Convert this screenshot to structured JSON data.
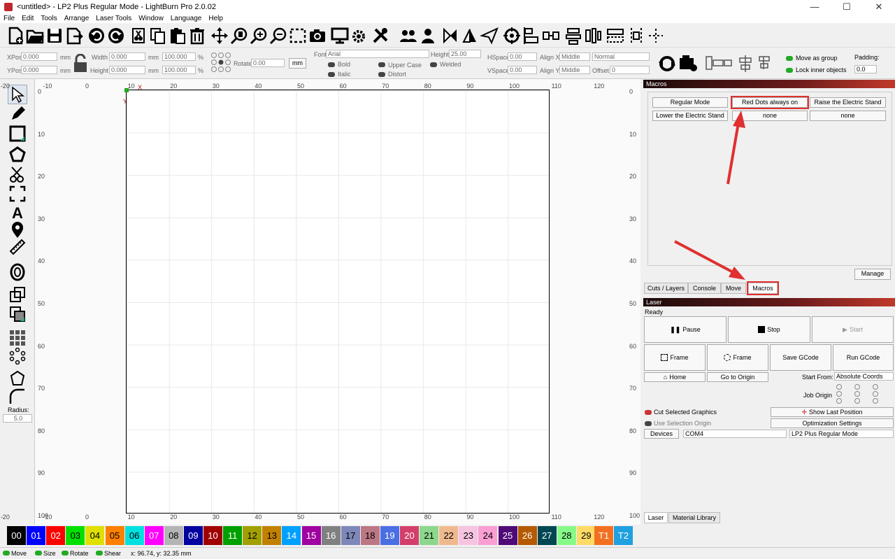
{
  "window": {
    "title": "<untitled> - LP2 Plus Regular Mode - LightBurn Pro 2.0.02",
    "minimize": "—",
    "maximize": "☐",
    "close": "✕"
  },
  "menu": [
    "File",
    "Edit",
    "Tools",
    "Arrange",
    "Laser Tools",
    "Window",
    "Language",
    "Help"
  ],
  "props": {
    "xpos_label": "XPos",
    "xpos_value": "0.000",
    "ypos_label": "YPos",
    "ypos_value": "0.000",
    "unit_mm": "mm",
    "width_label": "Width",
    "width_value": "0.000",
    "height_label": "Height",
    "height_value": "0.000",
    "scale_w": "100.000",
    "scale_h": "100.000",
    "percent": "%",
    "rotate_label": "Rotate",
    "rotate_value": "0.00",
    "mm_button": "mm",
    "font_label": "Font",
    "font_value": "Arial",
    "fheight_label": "Height",
    "fheight_value": "25.00",
    "bold": "Bold",
    "italic": "Italic",
    "upper": "Upper Case",
    "distort": "Distort",
    "welded": "Welded",
    "hspace_label": "HSpace",
    "hspace_value": "0.00",
    "vspace_label": "VSpace",
    "vspace_value": "0.00",
    "alignx_label": "Align X",
    "alignx_value": "Middle",
    "aligny_label": "Align Y",
    "aligny_value": "Middle",
    "normal": "Normal",
    "offset_label": "Offset",
    "offset_value": "0",
    "move_group": "Move as group",
    "lock_inner": "Lock inner objects",
    "padding_label": "Padding:",
    "padding_value": "0.0"
  },
  "left": {
    "radius_label": "Radius:",
    "radius_value": "5.0"
  },
  "ruler_top": [
    "-20",
    "-10",
    "0",
    "10",
    "20",
    "30",
    "40",
    "50",
    "60",
    "70",
    "80",
    "90",
    "100",
    "110",
    "120"
  ],
  "ruler_left": [
    "0",
    "10",
    "20",
    "30",
    "40",
    "50",
    "60",
    "70",
    "80",
    "90",
    "100"
  ],
  "axis_x": "X",
  "axis_y": "Y",
  "macros": {
    "title": "Macros",
    "buttons": [
      "Regular Mode",
      "Red Dots always on",
      "Raise the Electric Stand",
      "Lower the Electric Stand",
      "none",
      "none"
    ],
    "manage": "Manage",
    "tabs": [
      "Cuts / Layers",
      "Console",
      "Move",
      "Macros"
    ]
  },
  "laser": {
    "title": "Laser",
    "status": "Ready",
    "pause": "Pause",
    "stop": "Stop",
    "start": "Start",
    "frame1": "Frame",
    "frame2": "Frame",
    "save_gcode": "Save GCode",
    "run_gcode": "Run GCode",
    "home": "Home",
    "go_origin": "Go to Origin",
    "start_from_label": "Start From:",
    "start_from_value": "Absolute Coords",
    "job_origin": "Job Origin",
    "cut_selected": "Cut Selected Graphics",
    "use_sel_origin": "Use Selection Origin",
    "show_last": "Show Last Position",
    "opt_settings": "Optimization Settings",
    "devices": "Devices",
    "port": "COM4",
    "device": "LP2 Plus Regular Mode",
    "tabs": [
      "Laser",
      "Material Library"
    ]
  },
  "palette": [
    {
      "label": "00",
      "color": "#000000",
      "fg": "#ffffff"
    },
    {
      "label": "01",
      "color": "#0000ff",
      "fg": "#ffffff"
    },
    {
      "label": "02",
      "color": "#ff0000",
      "fg": "#ffffff"
    },
    {
      "label": "03",
      "color": "#00e000",
      "fg": "#000000"
    },
    {
      "label": "04",
      "color": "#e0e000",
      "fg": "#000000"
    },
    {
      "label": "05",
      "color": "#ff8000",
      "fg": "#000000"
    },
    {
      "label": "06",
      "color": "#00e0e0",
      "fg": "#000000"
    },
    {
      "label": "07",
      "color": "#ff00ff",
      "fg": "#ffffff"
    },
    {
      "label": "08",
      "color": "#b4b4b4",
      "fg": "#000000"
    },
    {
      "label": "09",
      "color": "#0000a0",
      "fg": "#ffffff"
    },
    {
      "label": "10",
      "color": "#a00000",
      "fg": "#ffffff"
    },
    {
      "label": "11",
      "color": "#00a000",
      "fg": "#ffffff"
    },
    {
      "label": "12",
      "color": "#a0a000",
      "fg": "#000000"
    },
    {
      "label": "13",
      "color": "#c08000",
      "fg": "#000000"
    },
    {
      "label": "14",
      "color": "#00a0ff",
      "fg": "#ffffff"
    },
    {
      "label": "15",
      "color": "#a000a0",
      "fg": "#ffffff"
    },
    {
      "label": "16",
      "color": "#808080",
      "fg": "#ffffff"
    },
    {
      "label": "17",
      "color": "#7d87b9",
      "fg": "#000000"
    },
    {
      "label": "18",
      "color": "#bb7784",
      "fg": "#000000"
    },
    {
      "label": "19",
      "color": "#4a6fe3",
      "fg": "#ffffff"
    },
    {
      "label": "20",
      "color": "#d33f6a",
      "fg": "#ffffff"
    },
    {
      "label": "21",
      "color": "#8cd78c",
      "fg": "#000000"
    },
    {
      "label": "22",
      "color": "#f0b98d",
      "fg": "#000000"
    },
    {
      "label": "23",
      "color": "#f6c4e1",
      "fg": "#000000"
    },
    {
      "label": "24",
      "color": "#fa9ed4",
      "fg": "#000000"
    },
    {
      "label": "25",
      "color": "#500a78",
      "fg": "#ffffff"
    },
    {
      "label": "26",
      "color": "#b45a00",
      "fg": "#ffffff"
    },
    {
      "label": "27",
      "color": "#004754",
      "fg": "#ffffff"
    },
    {
      "label": "28",
      "color": "#86fa88",
      "fg": "#000000"
    },
    {
      "label": "29",
      "color": "#ffdb66",
      "fg": "#000000"
    },
    {
      "label": "T1",
      "color": "#f37021",
      "fg": "#ffffff"
    },
    {
      "label": "T2",
      "color": "#1fa0e0",
      "fg": "#ffffff"
    }
  ],
  "status": {
    "move": "Move",
    "size": "Size",
    "rotate": "Rotate",
    "shear": "Shear",
    "coords": "x: 96.74, y: 32.35 mm"
  }
}
